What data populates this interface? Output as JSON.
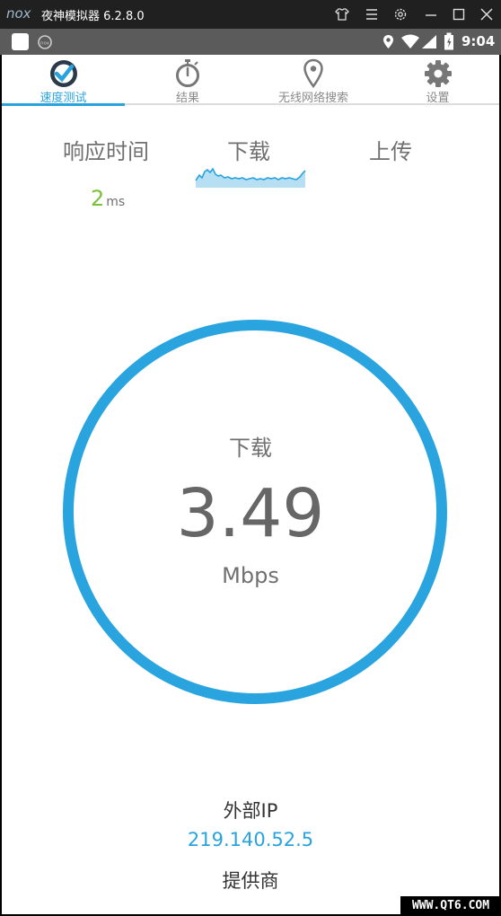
{
  "window": {
    "logo_text": "nox",
    "title": "夜神模拟器 6.2.8.0",
    "controls": [
      "shirt-icon",
      "menu-icon",
      "settings-icon",
      "minimize-icon",
      "maximize-icon",
      "close-icon"
    ]
  },
  "statusbar": {
    "time": "9:04",
    "icons": [
      "location-icon",
      "wifi-icon",
      "signal-icon",
      "battery-icon"
    ]
  },
  "tabs": [
    {
      "label": "速度测试",
      "icon": "speedometer-icon",
      "active": true
    },
    {
      "label": "结果",
      "icon": "stopwatch-icon",
      "active": false
    },
    {
      "label": "无线网络搜索",
      "icon": "map-pin-icon",
      "active": false
    },
    {
      "label": "设置",
      "icon": "gear-icon",
      "active": false
    }
  ],
  "metrics": {
    "ping_label": "响应时间",
    "download_label": "下载",
    "upload_label": "上传",
    "ping_value": "2",
    "ping_unit": "ms"
  },
  "gauge": {
    "label": "下载",
    "value": "3.49",
    "unit": "Mbps"
  },
  "info": {
    "ip_label": "外部IP",
    "ip_value": "219.140.52.5",
    "provider_label": "提供商"
  },
  "watermark": "WWW.QT6.COM",
  "colors": {
    "accent": "#29a3dd",
    "ping_green": "#7cbf3a"
  }
}
